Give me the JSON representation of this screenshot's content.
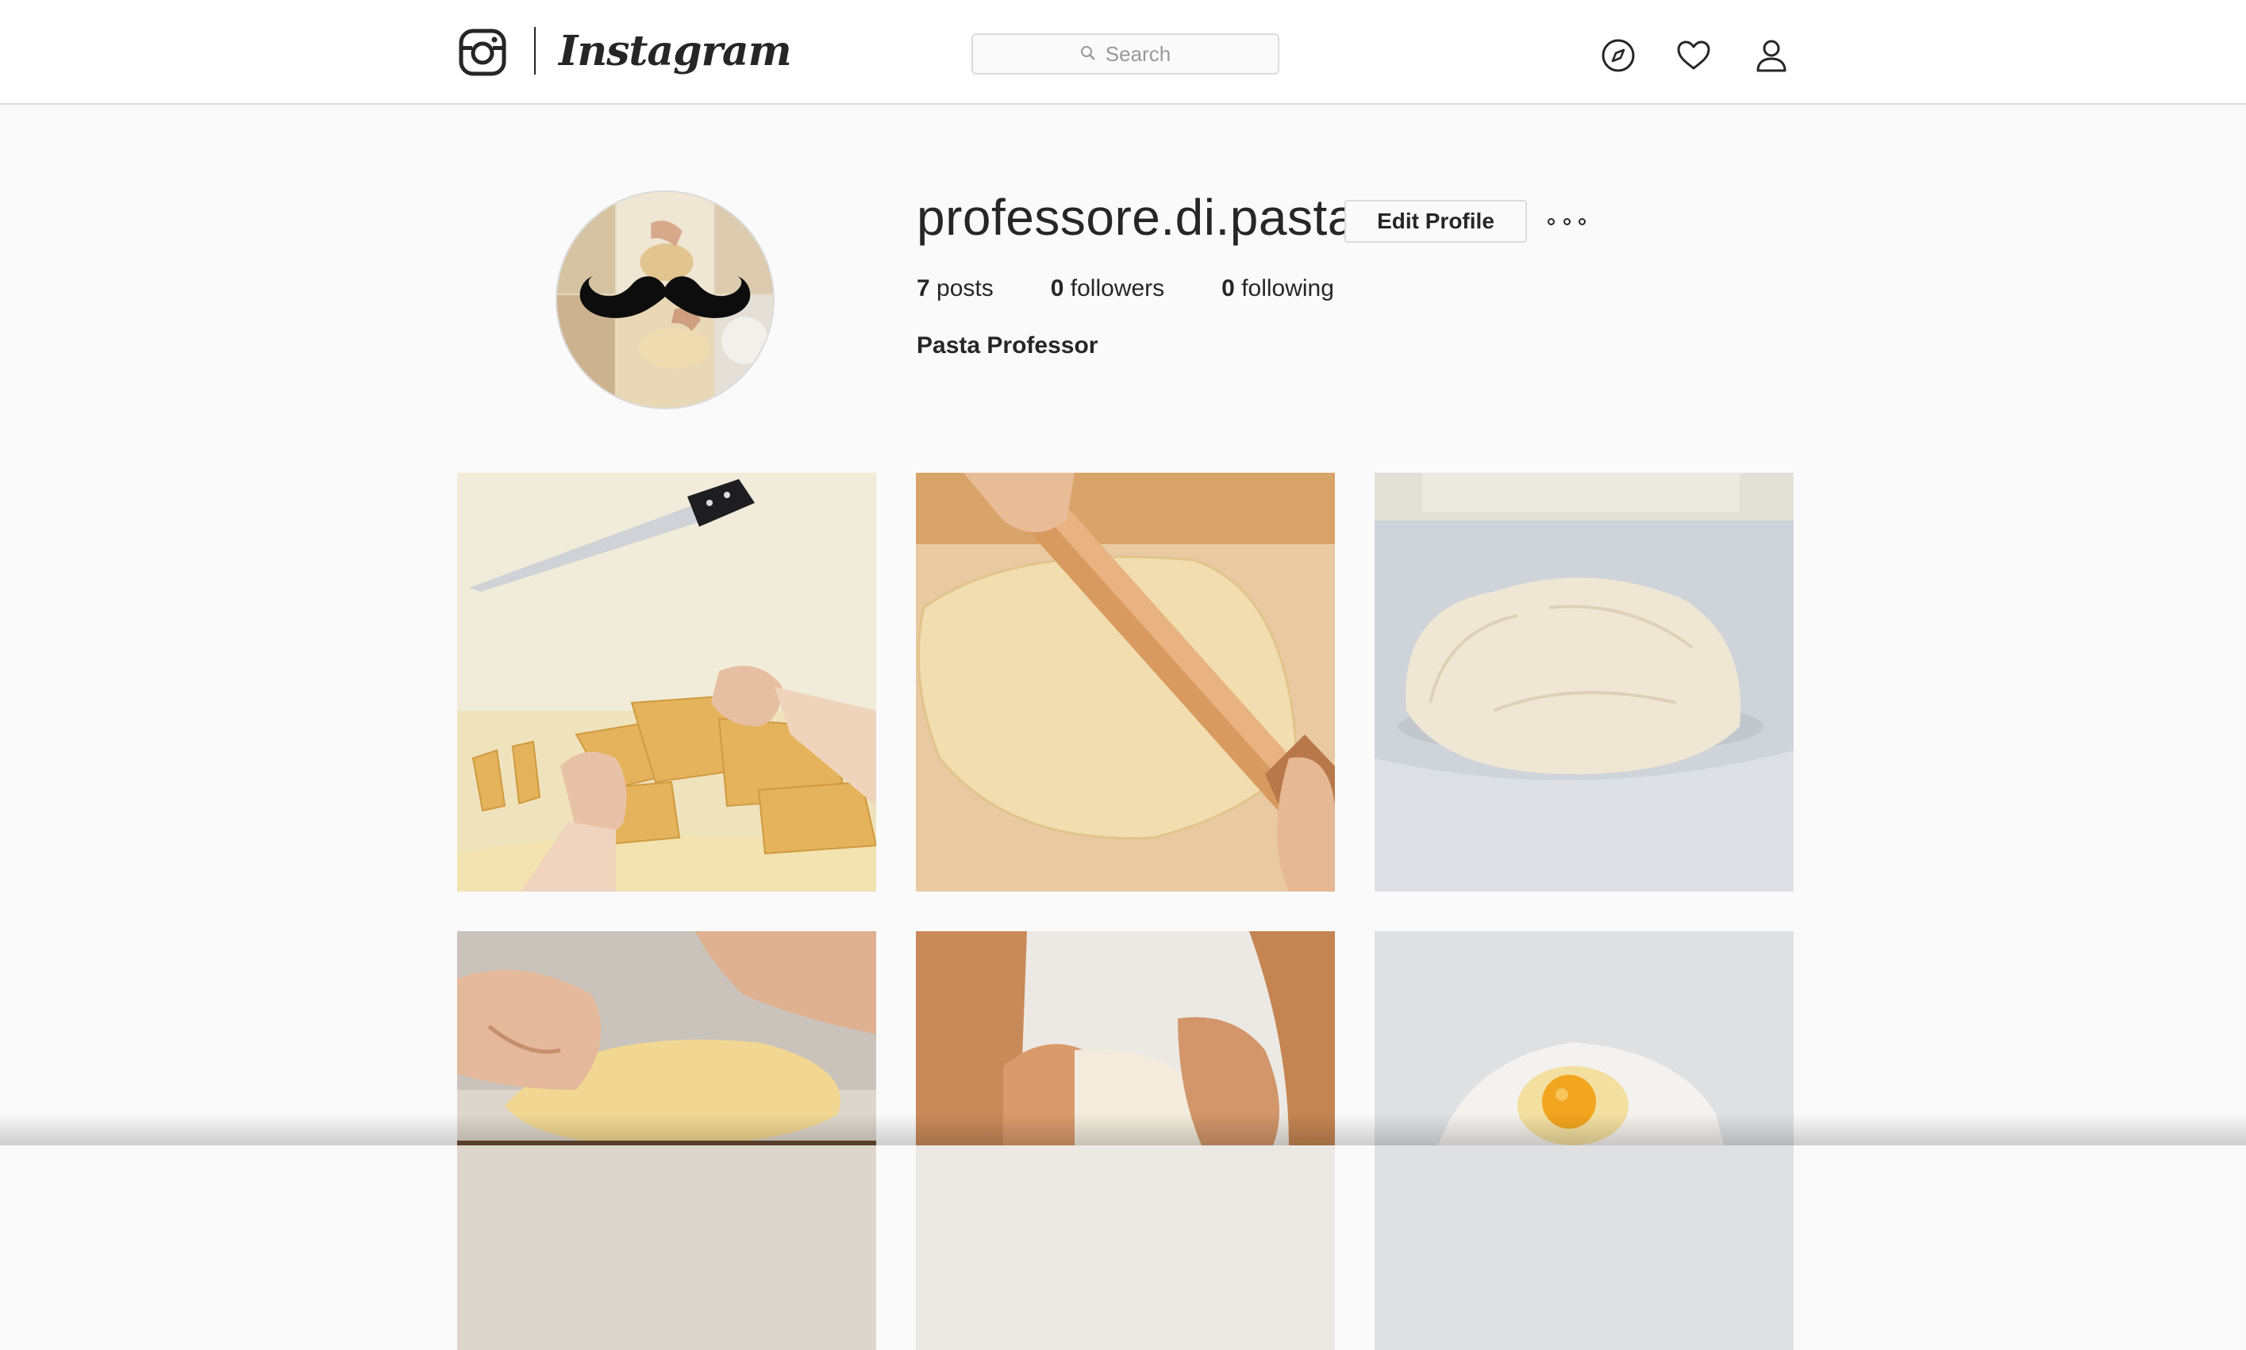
{
  "header": {
    "brand": "Instagram",
    "search_placeholder": "Search",
    "icons": [
      "instagram-glyph-icon",
      "search-icon",
      "explore-compass-icon",
      "heart-icon",
      "profile-person-icon"
    ]
  },
  "profile": {
    "username": "professore.di.pasta",
    "edit_profile_label": "Edit Profile",
    "stats": {
      "posts_count": "7",
      "posts_label": "posts",
      "followers_count": "0",
      "followers_label": "followers",
      "following_count": "0",
      "following_label": "following"
    },
    "full_name": "Pasta Professor"
  },
  "colors": {
    "background": "#fafafa",
    "text": "#262626",
    "border": "#dbdbdb",
    "placeholder": "#999999"
  }
}
